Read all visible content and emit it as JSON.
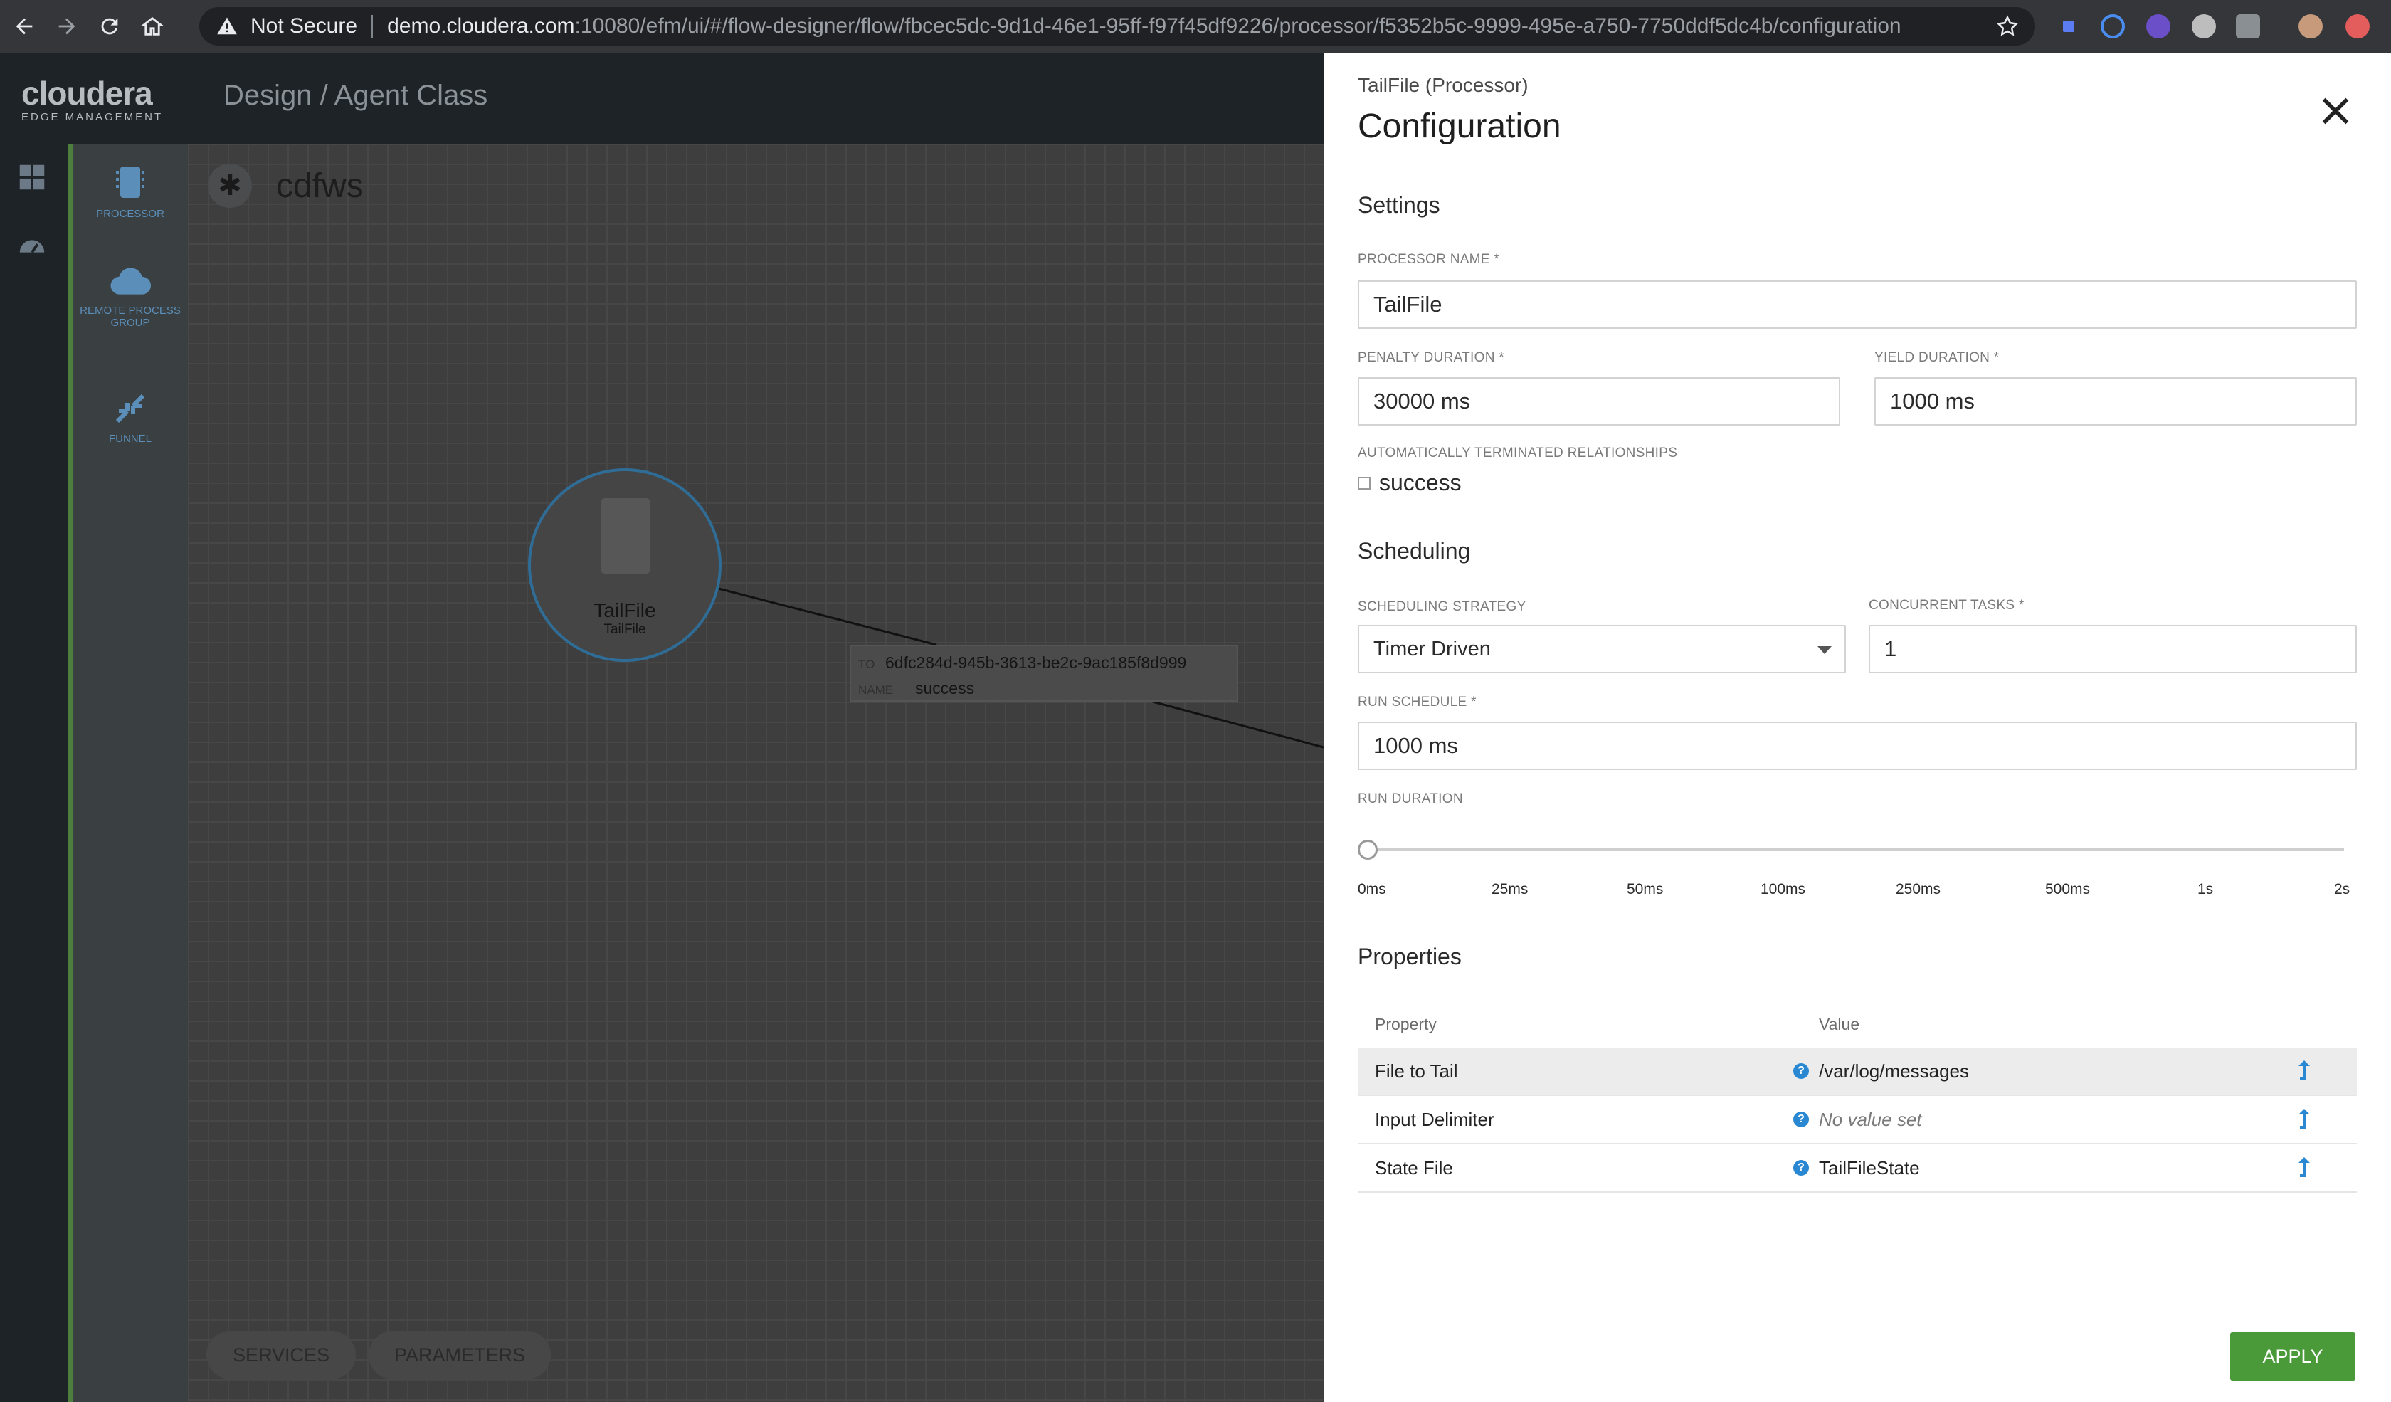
{
  "browser": {
    "security_label": "Not Secure",
    "url_host": "demo.cloudera.com",
    "url_path": ":10080/efm/ui/#/flow-designer/flow/fbcec5dc-9d1d-46e1-95ff-f97f45df9226/processor/f5352b5c-9999-495e-a750-7750ddf5dc4b/configuration"
  },
  "app": {
    "logo_text": "cloudera",
    "logo_subtext": "EDGE MANAGEMENT",
    "breadcrumb": "Design / Agent Class"
  },
  "palette": {
    "items": [
      {
        "label": "PROCESSOR",
        "icon": "processor-icon"
      },
      {
        "label": "REMOTE PROCESS GROUP",
        "icon": "cloud-icon"
      },
      {
        "label": "FUNNEL",
        "icon": "funnel-icon"
      }
    ]
  },
  "canvas": {
    "flow_name": "cdfws",
    "processor": {
      "name": "TailFile",
      "type": "TailFile"
    },
    "connection": {
      "to_key": "TO",
      "to_value": "6dfc284d-945b-3613-be2c-9ac185f8d999",
      "name_key": "NAME",
      "name_value": "success"
    },
    "buttons": {
      "services": "SERVICES",
      "parameters": "PARAMETERS"
    }
  },
  "panel": {
    "subtitle": "TailFile (Processor)",
    "title": "Configuration",
    "settings": {
      "heading": "Settings",
      "processor_name_label": "PROCESSOR NAME *",
      "processor_name_value": "TailFile",
      "penalty_label": "PENALTY DURATION *",
      "penalty_value": "30000 ms",
      "yield_label": "YIELD DURATION *",
      "yield_value": "1000 ms",
      "auto_term_label": "AUTOMATICALLY TERMINATED RELATIONSHIPS",
      "auto_term_option": "success",
      "auto_term_checked": false
    },
    "scheduling": {
      "heading": "Scheduling",
      "strategy_label": "SCHEDULING STRATEGY",
      "strategy_value": "Timer Driven",
      "concurrent_label": "CONCURRENT TASKS *",
      "concurrent_value": "1",
      "run_schedule_label": "RUN SCHEDULE *",
      "run_schedule_value": "1000 ms",
      "run_duration_label": "RUN DURATION",
      "run_duration_ticks": [
        "0ms",
        "25ms",
        "50ms",
        "100ms",
        "250ms",
        "500ms",
        "1s",
        "2s"
      ],
      "run_duration_selected": "0ms"
    },
    "properties": {
      "heading": "Properties",
      "col_property": "Property",
      "col_value": "Value",
      "rows": [
        {
          "name": "File to Tail",
          "value": "/var/log/messages",
          "selected": true
        },
        {
          "name": "Input Delimiter",
          "value": "No value set",
          "selected": false
        },
        {
          "name": "State File",
          "value": "TailFileState",
          "selected": false
        }
      ]
    },
    "apply_label": "APPLY"
  },
  "colors": {
    "accent_green": "#4a9a3a",
    "link_blue": "#2a88d2",
    "node_border": "#2f6d96"
  }
}
